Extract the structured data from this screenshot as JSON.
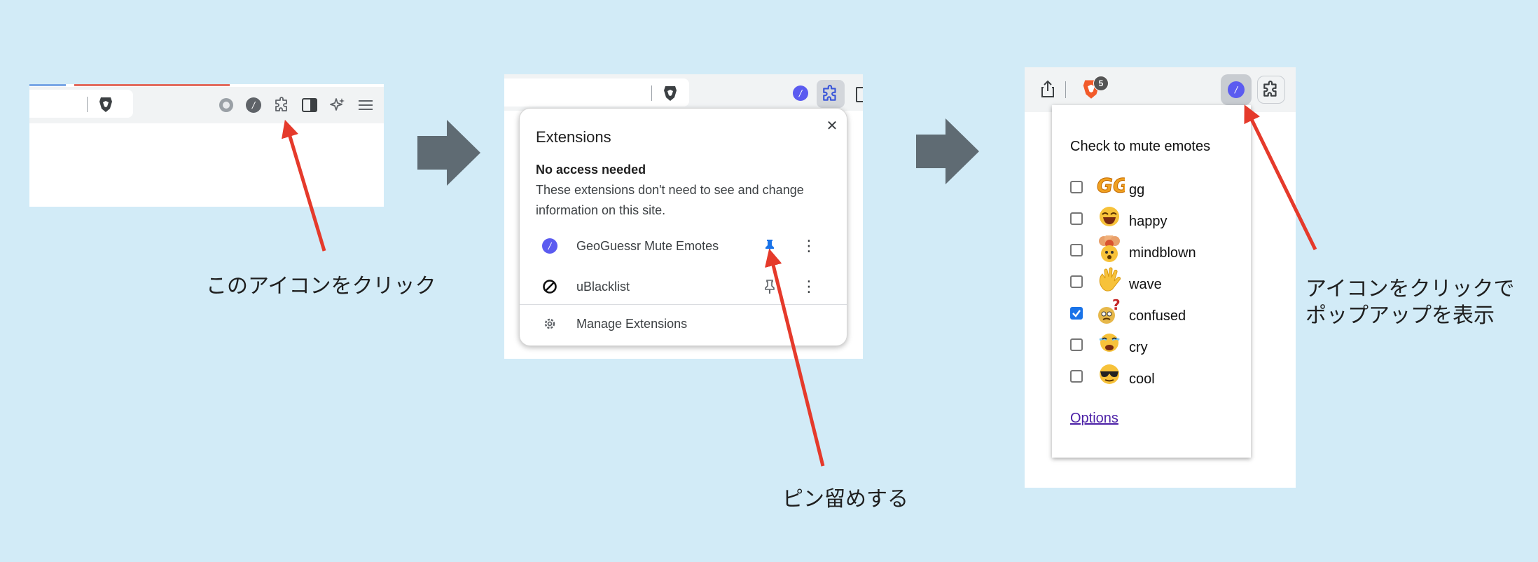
{
  "colors": {
    "background": "#d2ebf7",
    "arrow_red": "#e53a2b",
    "flow_arrow": "#5f6b73",
    "extension_purple": "#5b5bf0",
    "pin_blue": "#1a73e8",
    "checkbox_blue": "#1a73e8"
  },
  "step1": {
    "caption": "このアイコンをクリック",
    "toolbar_icons": [
      "brave-lion-icon",
      "record-icon",
      "extension-slash-icon",
      "puzzle-icon",
      "sidebar-icon",
      "sparkle-icon",
      "menu-icon"
    ],
    "extension_glyph": "/"
  },
  "step2": {
    "menu_title": "Extensions",
    "section_heading": "No access needed",
    "section_description": "These extensions don't need to see and change information on this site.",
    "extensions": [
      {
        "name": "GeoGuessr Mute Emotes",
        "pinned": true,
        "icon": "slash-circle-icon",
        "glyph": "/"
      },
      {
        "name": "uBlacklist",
        "pinned": false,
        "icon": "block-icon"
      }
    ],
    "manage_label": "Manage Extensions",
    "close_glyph": "✕",
    "more_glyph": "⋮",
    "caption": "ピン留めする"
  },
  "step3": {
    "brave_badge_count": "5",
    "extension_glyph": "/",
    "popup_title": "Check to mute emotes",
    "emotes": [
      {
        "label": "gg",
        "checked": false,
        "icon": "gg-emote-icon"
      },
      {
        "label": "happy",
        "checked": false,
        "icon": "happy-emote-icon"
      },
      {
        "label": "mindblown",
        "checked": false,
        "icon": "mindblown-emote-icon"
      },
      {
        "label": "wave",
        "checked": false,
        "icon": "wave-emote-icon"
      },
      {
        "label": "confused",
        "checked": true,
        "icon": "confused-emote-icon"
      },
      {
        "label": "cry",
        "checked": false,
        "icon": "cry-emote-icon"
      },
      {
        "label": "cool",
        "checked": false,
        "icon": "cool-emote-icon"
      }
    ],
    "options_label": "Options",
    "caption_line1": "アイコンをクリックで",
    "caption_line2": "ポップアップを表示"
  }
}
